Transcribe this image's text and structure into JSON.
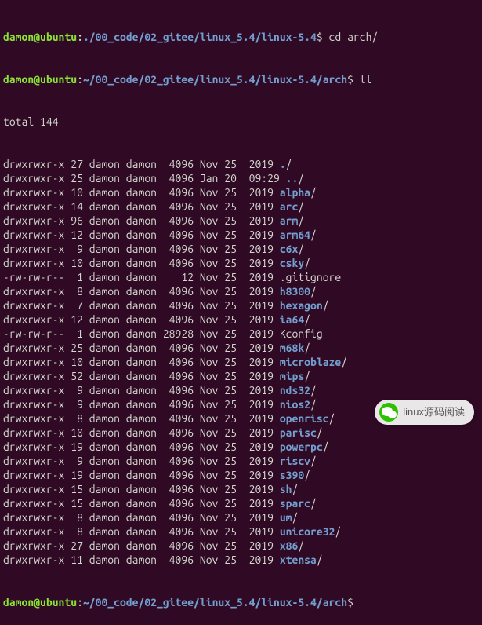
{
  "prompt1": {
    "cutoff_user": "damon@ubuntu",
    "cutoff_path": "./00_code/02_gitee/linux_5.4/linux-5.4",
    "cutoff_cmd": "cd arch/"
  },
  "prompt2": {
    "user": "damon@ubuntu",
    "sep": ":",
    "path": "~/00_code/02_gitee/linux_5.4/linux-5.4/arch",
    "dollar": "$ ",
    "cmd": "ll"
  },
  "total_line": "total 144",
  "listing": [
    {
      "perm": "drwxrwxr-x",
      "links": "27",
      "owner": "damon",
      "group": "damon",
      "size": "4096",
      "mon": "Nov",
      "day": "25",
      "time": "2019",
      "name": "./",
      "is_dir": true
    },
    {
      "perm": "drwxrwxr-x",
      "links": "25",
      "owner": "damon",
      "group": "damon",
      "size": "4096",
      "mon": "Jan",
      "day": "20",
      "time": "09:29",
      "name": "../",
      "is_dir": true
    },
    {
      "perm": "drwxrwxr-x",
      "links": "10",
      "owner": "damon",
      "group": "damon",
      "size": "4096",
      "mon": "Nov",
      "day": "25",
      "time": "2019",
      "name": "alpha/",
      "is_dir": true
    },
    {
      "perm": "drwxrwxr-x",
      "links": "14",
      "owner": "damon",
      "group": "damon",
      "size": "4096",
      "mon": "Nov",
      "day": "25",
      "time": "2019",
      "name": "arc/",
      "is_dir": true
    },
    {
      "perm": "drwxrwxr-x",
      "links": "96",
      "owner": "damon",
      "group": "damon",
      "size": "4096",
      "mon": "Nov",
      "day": "25",
      "time": "2019",
      "name": "arm/",
      "is_dir": true
    },
    {
      "perm": "drwxrwxr-x",
      "links": "12",
      "owner": "damon",
      "group": "damon",
      "size": "4096",
      "mon": "Nov",
      "day": "25",
      "time": "2019",
      "name": "arm64/",
      "is_dir": true
    },
    {
      "perm": "drwxrwxr-x",
      "links": "9",
      "owner": "damon",
      "group": "damon",
      "size": "4096",
      "mon": "Nov",
      "day": "25",
      "time": "2019",
      "name": "c6x/",
      "is_dir": true
    },
    {
      "perm": "drwxrwxr-x",
      "links": "10",
      "owner": "damon",
      "group": "damon",
      "size": "4096",
      "mon": "Nov",
      "day": "25",
      "time": "2019",
      "name": "csky/",
      "is_dir": true
    },
    {
      "perm": "-rw-rw-r--",
      "links": "1",
      "owner": "damon",
      "group": "damon",
      "size": "12",
      "mon": "Nov",
      "day": "25",
      "time": "2019",
      "name": ".gitignore",
      "is_dir": false
    },
    {
      "perm": "drwxrwxr-x",
      "links": "8",
      "owner": "damon",
      "group": "damon",
      "size": "4096",
      "mon": "Nov",
      "day": "25",
      "time": "2019",
      "name": "h8300/",
      "is_dir": true
    },
    {
      "perm": "drwxrwxr-x",
      "links": "7",
      "owner": "damon",
      "group": "damon",
      "size": "4096",
      "mon": "Nov",
      "day": "25",
      "time": "2019",
      "name": "hexagon/",
      "is_dir": true
    },
    {
      "perm": "drwxrwxr-x",
      "links": "12",
      "owner": "damon",
      "group": "damon",
      "size": "4096",
      "mon": "Nov",
      "day": "25",
      "time": "2019",
      "name": "ia64/",
      "is_dir": true
    },
    {
      "perm": "-rw-rw-r--",
      "links": "1",
      "owner": "damon",
      "group": "damon",
      "size": "28928",
      "mon": "Nov",
      "day": "25",
      "time": "2019",
      "name": "Kconfig",
      "is_dir": false
    },
    {
      "perm": "drwxrwxr-x",
      "links": "25",
      "owner": "damon",
      "group": "damon",
      "size": "4096",
      "mon": "Nov",
      "day": "25",
      "time": "2019",
      "name": "m68k/",
      "is_dir": true
    },
    {
      "perm": "drwxrwxr-x",
      "links": "10",
      "owner": "damon",
      "group": "damon",
      "size": "4096",
      "mon": "Nov",
      "day": "25",
      "time": "2019",
      "name": "microblaze/",
      "is_dir": true
    },
    {
      "perm": "drwxrwxr-x",
      "links": "52",
      "owner": "damon",
      "group": "damon",
      "size": "4096",
      "mon": "Nov",
      "day": "25",
      "time": "2019",
      "name": "mips/",
      "is_dir": true
    },
    {
      "perm": "drwxrwxr-x",
      "links": "9",
      "owner": "damon",
      "group": "damon",
      "size": "4096",
      "mon": "Nov",
      "day": "25",
      "time": "2019",
      "name": "nds32/",
      "is_dir": true
    },
    {
      "perm": "drwxrwxr-x",
      "links": "9",
      "owner": "damon",
      "group": "damon",
      "size": "4096",
      "mon": "Nov",
      "day": "25",
      "time": "2019",
      "name": "nios2/",
      "is_dir": true
    },
    {
      "perm": "drwxrwxr-x",
      "links": "8",
      "owner": "damon",
      "group": "damon",
      "size": "4096",
      "mon": "Nov",
      "day": "25",
      "time": "2019",
      "name": "openrisc/",
      "is_dir": true
    },
    {
      "perm": "drwxrwxr-x",
      "links": "10",
      "owner": "damon",
      "group": "damon",
      "size": "4096",
      "mon": "Nov",
      "day": "25",
      "time": "2019",
      "name": "parisc/",
      "is_dir": true
    },
    {
      "perm": "drwxrwxr-x",
      "links": "19",
      "owner": "damon",
      "group": "damon",
      "size": "4096",
      "mon": "Nov",
      "day": "25",
      "time": "2019",
      "name": "powerpc/",
      "is_dir": true
    },
    {
      "perm": "drwxrwxr-x",
      "links": "9",
      "owner": "damon",
      "group": "damon",
      "size": "4096",
      "mon": "Nov",
      "day": "25",
      "time": "2019",
      "name": "riscv/",
      "is_dir": true
    },
    {
      "perm": "drwxrwxr-x",
      "links": "19",
      "owner": "damon",
      "group": "damon",
      "size": "4096",
      "mon": "Nov",
      "day": "25",
      "time": "2019",
      "name": "s390/",
      "is_dir": true
    },
    {
      "perm": "drwxrwxr-x",
      "links": "15",
      "owner": "damon",
      "group": "damon",
      "size": "4096",
      "mon": "Nov",
      "day": "25",
      "time": "2019",
      "name": "sh/",
      "is_dir": true
    },
    {
      "perm": "drwxrwxr-x",
      "links": "15",
      "owner": "damon",
      "group": "damon",
      "size": "4096",
      "mon": "Nov",
      "day": "25",
      "time": "2019",
      "name": "sparc/",
      "is_dir": true
    },
    {
      "perm": "drwxrwxr-x",
      "links": "8",
      "owner": "damon",
      "group": "damon",
      "size": "4096",
      "mon": "Nov",
      "day": "25",
      "time": "2019",
      "name": "um/",
      "is_dir": true
    },
    {
      "perm": "drwxrwxr-x",
      "links": "8",
      "owner": "damon",
      "group": "damon",
      "size": "4096",
      "mon": "Nov",
      "day": "25",
      "time": "2019",
      "name": "unicore32/",
      "is_dir": true
    },
    {
      "perm": "drwxrwxr-x",
      "links": "27",
      "owner": "damon",
      "group": "damon",
      "size": "4096",
      "mon": "Nov",
      "day": "25",
      "time": "2019",
      "name": "x86/",
      "is_dir": true
    },
    {
      "perm": "drwxrwxr-x",
      "links": "11",
      "owner": "damon",
      "group": "damon",
      "size": "4096",
      "mon": "Nov",
      "day": "25",
      "time": "2019",
      "name": "xtensa/",
      "is_dir": true
    }
  ],
  "prompt3": {
    "user": "damon@ubuntu",
    "sep": ":",
    "path": "~/00_code/02_gitee/linux_5.4/linux-5.4/arch",
    "dollar": "$ "
  },
  "watermark": "linux源码阅读"
}
